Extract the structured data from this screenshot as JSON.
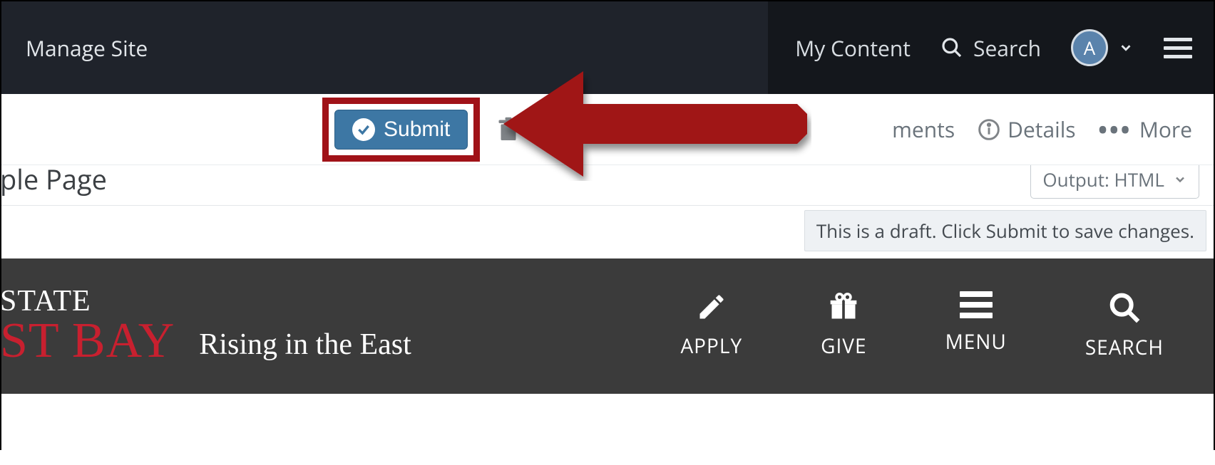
{
  "topnav": {
    "manage_site": "Manage Site",
    "my_content": "My Content",
    "search": "Search",
    "avatar_initial": "A"
  },
  "actionbar": {
    "submit": "Submit",
    "comments_fragment": "ments",
    "details": "Details",
    "more": "More"
  },
  "page": {
    "title_fragment": "ple Page",
    "output_label": "Output: HTML"
  },
  "draft_notice": "This is a draft. Click Submit to save changes.",
  "site_preview": {
    "brand_line1": "STATE",
    "brand_line2": "ST BAY",
    "brand_tagline": "Rising in the East",
    "nav": {
      "apply": "APPLY",
      "give": "GIVE",
      "menu": "MENU",
      "search": "SEARCH"
    }
  }
}
